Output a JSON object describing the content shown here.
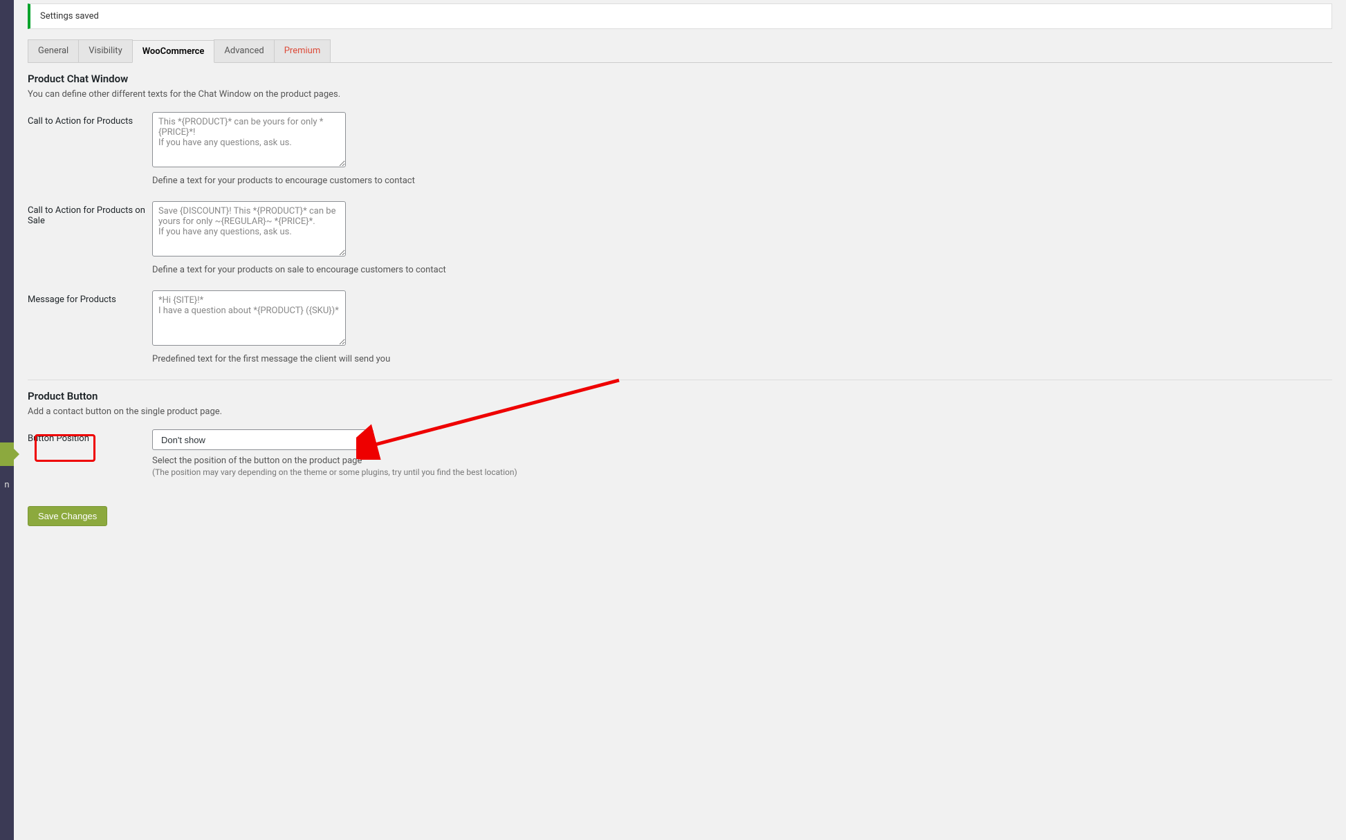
{
  "notice": {
    "text": "Settings saved"
  },
  "tabs": {
    "general": "General",
    "visibility": "Visibility",
    "woocommerce": "WooCommerce",
    "advanced": "Advanced",
    "premium": "Premium"
  },
  "sidebar": {
    "fragment": "n"
  },
  "section1": {
    "title": "Product Chat Window",
    "desc": "You can define other different texts for the Chat Window on the product pages."
  },
  "cta_products": {
    "label": "Call to Action for Products",
    "placeholder": "This *{PRODUCT}* can be yours for only *{PRICE}*!\nIf you have any questions, ask us.",
    "help": "Define a text for your products to encourage customers to contact"
  },
  "cta_sale": {
    "label": "Call to Action for Products on Sale",
    "placeholder": "Save {DISCOUNT}! This *{PRODUCT}* can be yours for only ~{REGULAR}~ *{PRICE}*.\nIf you have any questions, ask us.",
    "help": "Define a text for your products on sale to encourage customers to contact"
  },
  "msg_products": {
    "label": "Message for Products",
    "placeholder": "*Hi {SITE}!*\nI have a question about *{PRODUCT} ({SKU})*",
    "help": "Predefined text for the first message the client will send you"
  },
  "section2": {
    "title": "Product Button",
    "desc": "Add a contact button on the single product page."
  },
  "button_position": {
    "label": "Button Position",
    "selected": "Don't show",
    "help": "Select the position of the button on the product page",
    "help_sub": "(The position may vary depending on the theme or some plugins, try until you find the best location)"
  },
  "save_button": "Save Changes"
}
